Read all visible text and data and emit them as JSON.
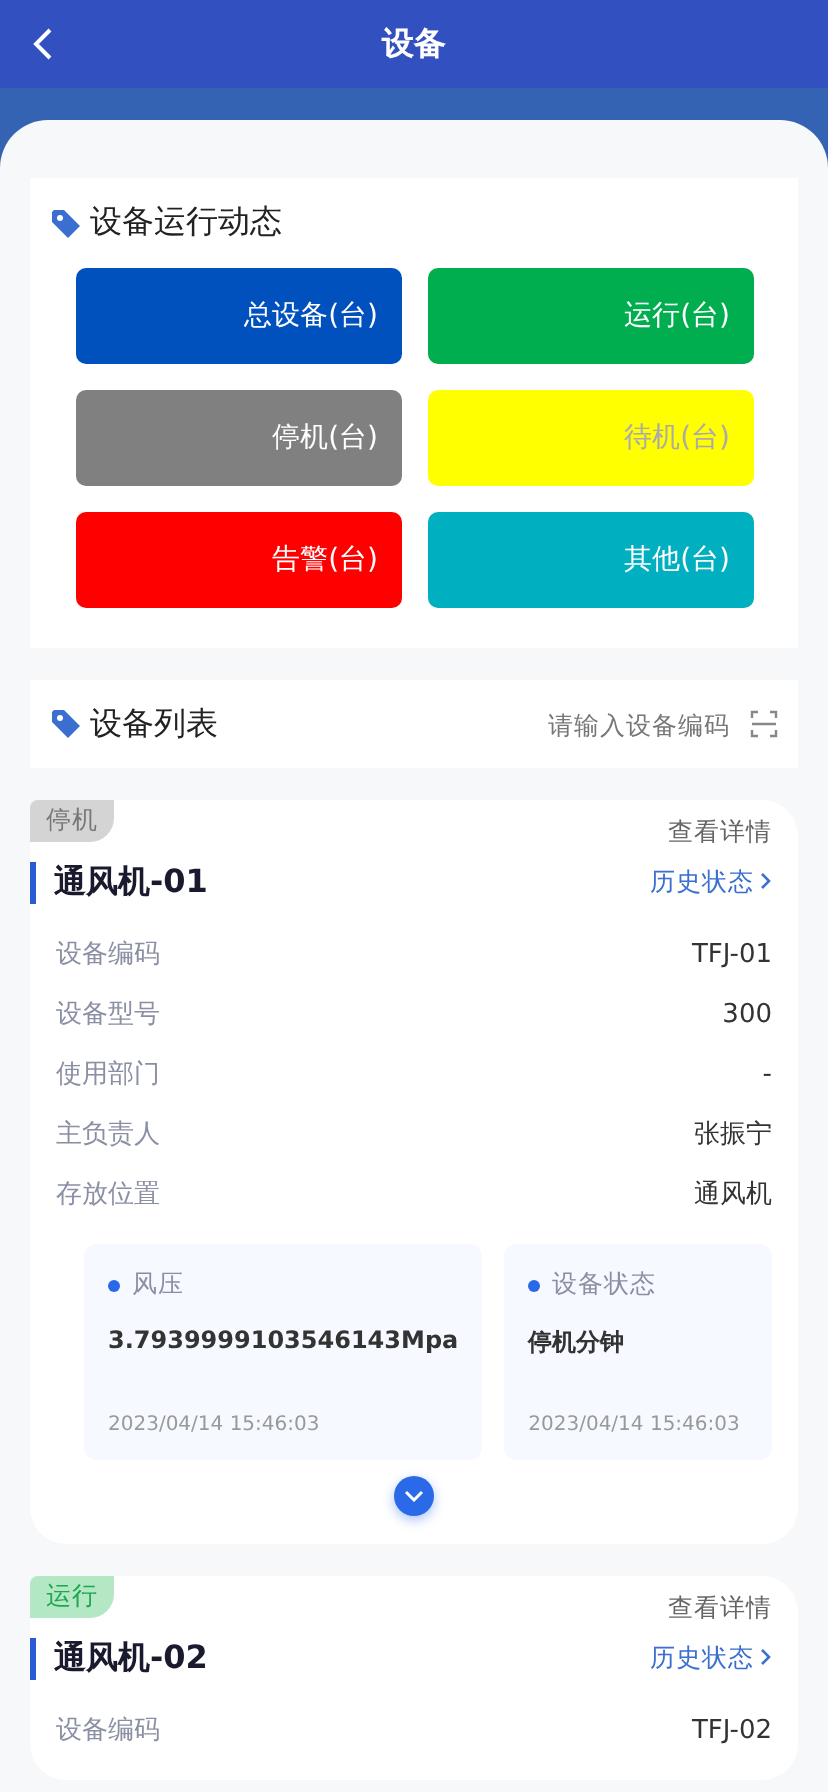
{
  "header": {
    "title": "设备"
  },
  "overview": {
    "title": "设备运行动态",
    "tiles": [
      {
        "label": "总设备(台)",
        "color": "#0050be"
      },
      {
        "label": "运行(台)",
        "color": "#00ad4f"
      },
      {
        "label": "停机(台)",
        "color": "#808080"
      },
      {
        "label": "待机(台)",
        "color": "#ffff00"
      },
      {
        "label": "告警(台)",
        "color": "#ff0000"
      },
      {
        "label": "其他(台)",
        "color": "#00b0c0"
      }
    ]
  },
  "list": {
    "title": "设备列表",
    "search": {
      "placeholder": "请输入设备编码"
    }
  },
  "devices": [
    {
      "status": {
        "label": "停机",
        "kind": "stopped"
      },
      "detail_link": "查看详情",
      "name": "通风机-01",
      "history_link": "历史状态",
      "fields": [
        {
          "label": "设备编码",
          "value": "TFJ-01"
        },
        {
          "label": "设备型号",
          "value": "300"
        },
        {
          "label": "使用部门",
          "value": "-"
        },
        {
          "label": "主负责人",
          "value": "张振宁"
        },
        {
          "label": "存放位置",
          "value": "通风机"
        }
      ],
      "metrics": [
        {
          "label": "风压",
          "value": "3.7939999103546143Mpa",
          "time": "2023/04/14 15:46:03"
        },
        {
          "label": "设备状态",
          "value": "停机分钟",
          "time": "2023/04/14 15:46:03"
        }
      ]
    },
    {
      "status": {
        "label": "运行",
        "kind": "running"
      },
      "detail_link": "查看详情",
      "name": "通风机-02",
      "history_link": "历史状态",
      "fields": [
        {
          "label": "设备编码",
          "value": "TFJ-02"
        }
      ]
    }
  ]
}
